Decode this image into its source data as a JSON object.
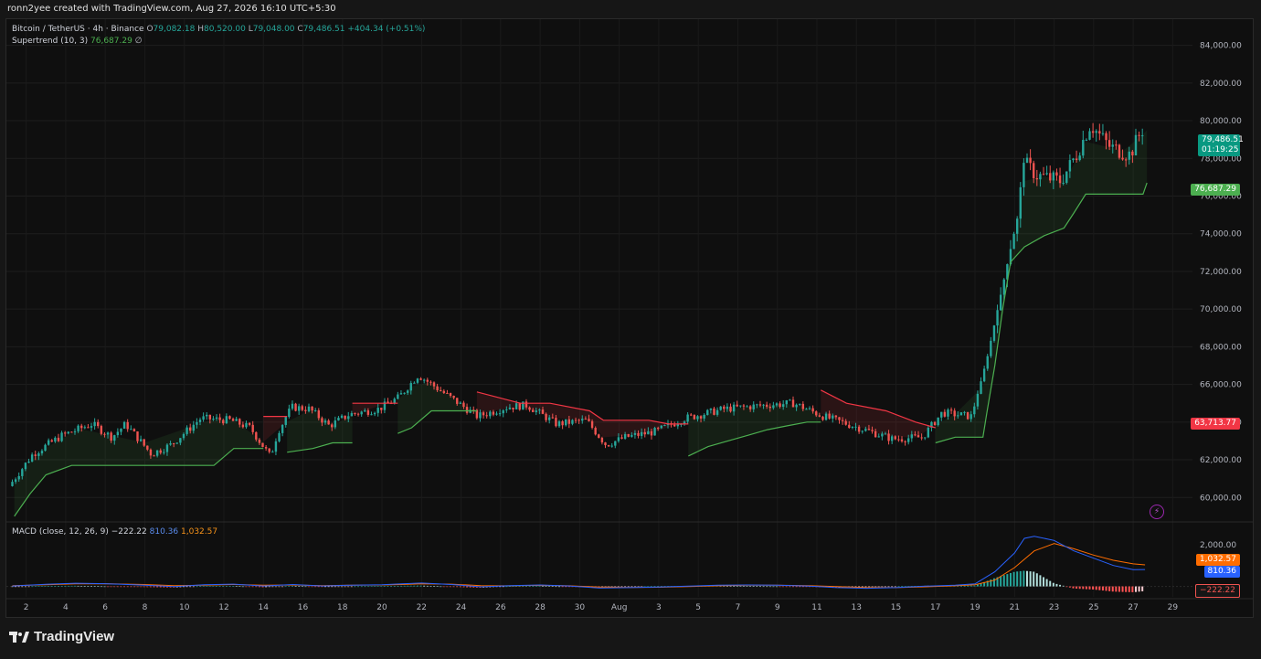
{
  "header": {
    "attribution": "ronn2yee created with TradingView.com, Aug 27, 2026 16:10 UTC+5:30"
  },
  "legend": {
    "symbol": "Bitcoin / TetherUS · 4h · Binance",
    "o_label": "O",
    "o_value": "79,082.18",
    "h_label": "H",
    "h_value": "80,520.00",
    "l_label": "L",
    "l_value": "79,048.00",
    "c_label": "C",
    "c_value": "79,486.51",
    "change": "+404.34 (+0.51%)",
    "supertrend_label": "Supertrend (10, 3)",
    "supertrend_value": "76,687.29",
    "supertrend_extra": "∅"
  },
  "macd_legend": {
    "label": "MACD (close, 12, 26, 9)",
    "hist_value": "−222.22",
    "macd_value": "810.36",
    "signal_value": "1,032.57"
  },
  "price_tags": {
    "last_price": "79,486.51",
    "countdown": "01:19:25",
    "supertrend": "76,687.29",
    "downtrend": "63,713.77",
    "signal": "1,032.57",
    "macd": "810.36",
    "hist": "−222.22"
  },
  "colors": {
    "up": "#26a69a",
    "down": "#ef5350",
    "supertrend_up": "#4caf50",
    "supertrend_down": "#f23645",
    "macd": "#2962ff",
    "signal": "#ff6d00",
    "background": "#0f0f0f"
  },
  "footer": {
    "brand": "TradingView",
    "logo_icon": "tradingview-logo-icon"
  },
  "chart_data": {
    "type": "candlestick",
    "title": "Bitcoin / TetherUS · 4h · Binance",
    "y_ticks": [
      "84,000.00",
      "82,000.00",
      "80,000.00",
      "78,000.00",
      "76,000.00",
      "74,000.00",
      "72,000.00",
      "70,000.00",
      "68,000.00",
      "66,000.00",
      "64,000.00",
      "62,000.00",
      "60,000.00"
    ],
    "y_tick_values": [
      84000,
      82000,
      80000,
      78000,
      76000,
      74000,
      72000,
      70000,
      68000,
      66000,
      64000,
      62000,
      60000
    ],
    "ylim": [
      58800,
      85000
    ],
    "x_ticks": [
      "2",
      "4",
      "6",
      "8",
      "10",
      "12",
      "14",
      "16",
      "18",
      "20",
      "22",
      "24",
      "26",
      "28",
      "30",
      "Aug",
      "3",
      "5",
      "7",
      "9",
      "11",
      "13",
      "15",
      "17",
      "19",
      "21",
      "23",
      "25",
      "27",
      "29"
    ],
    "x_tick_days": [
      2,
      4,
      6,
      8,
      10,
      12,
      14,
      16,
      18,
      20,
      22,
      24,
      26,
      28,
      30,
      32,
      34,
      36,
      38,
      40,
      42,
      44,
      46,
      48,
      50,
      52,
      54,
      56,
      58,
      60
    ],
    "price_anchors": [
      [
        1.3,
        60600
      ],
      [
        2.5,
        62300
      ],
      [
        4.0,
        63300
      ],
      [
        5.5,
        63900
      ],
      [
        6.5,
        63200
      ],
      [
        7.2,
        63900
      ],
      [
        8.5,
        62300
      ],
      [
        9.5,
        62800
      ],
      [
        11,
        64200
      ],
      [
        12.5,
        64100
      ],
      [
        13.5,
        63700
      ],
      [
        14.5,
        62200
      ],
      [
        15.5,
        64800
      ],
      [
        16.5,
        64700
      ],
      [
        17.5,
        63800
      ],
      [
        18.5,
        64400
      ],
      [
        20,
        64700
      ],
      [
        21,
        65300
      ],
      [
        22,
        66500
      ],
      [
        23.5,
        65400
      ],
      [
        25,
        64300
      ],
      [
        26.5,
        64800
      ],
      [
        27.5,
        64900
      ],
      [
        29,
        63900
      ],
      [
        30.5,
        64100
      ],
      [
        31.5,
        62800
      ],
      [
        32.5,
        63200
      ],
      [
        34,
        63500
      ],
      [
        35.5,
        64200
      ],
      [
        37.5,
        64700
      ],
      [
        39.5,
        64900
      ],
      [
        41,
        65000
      ],
      [
        42.5,
        64300
      ],
      [
        44,
        63800
      ],
      [
        46,
        63100
      ],
      [
        47.5,
        63200
      ],
      [
        48.5,
        64500
      ],
      [
        50,
        64300
      ],
      [
        50.8,
        67500
      ],
      [
        51.7,
        71900
      ],
      [
        52.3,
        74800
      ],
      [
        52.6,
        77800
      ],
      [
        53.3,
        77100
      ],
      [
        54.5,
        76800
      ],
      [
        55.3,
        78200
      ],
      [
        56.0,
        79800
      ],
      [
        57.0,
        78600
      ],
      [
        58.0,
        78200
      ],
      [
        58.6,
        79500
      ]
    ],
    "supertrend": {
      "value": 76687.29,
      "segments": [
        {
          "trend": "up",
          "points": [
            [
              1.4,
              59000
            ],
            [
              2.2,
              60200
            ],
            [
              3.0,
              61200
            ],
            [
              4.3,
              61700
            ],
            [
              4.8,
              61700
            ],
            [
              8.0,
              61700
            ],
            [
              11.5,
              61700
            ],
            [
              12.5,
              62600
            ],
            [
              14.0,
              62600
            ]
          ]
        },
        {
          "trend": "down",
          "points": [
            [
              14.0,
              64300
            ],
            [
              15.2,
              64300
            ]
          ]
        },
        {
          "trend": "up",
          "points": [
            [
              15.2,
              62400
            ],
            [
              16.5,
              62600
            ],
            [
              17.5,
              62900
            ],
            [
              18.5,
              62900
            ]
          ]
        },
        {
          "trend": "down",
          "points": [
            [
              18.5,
              65000
            ],
            [
              20.8,
              65000
            ]
          ]
        },
        {
          "trend": "up",
          "points": [
            [
              20.8,
              63400
            ],
            [
              21.5,
              63700
            ],
            [
              22.5,
              64600
            ],
            [
              24.8,
              64600
            ]
          ]
        },
        {
          "trend": "down",
          "points": [
            [
              24.8,
              65600
            ],
            [
              27.0,
              65000
            ],
            [
              28.5,
              65000
            ],
            [
              30.5,
              64600
            ],
            [
              31.2,
              64100
            ],
            [
              33.5,
              64100
            ],
            [
              34.5,
              63900
            ],
            [
              35.5,
              63900
            ]
          ]
        },
        {
          "trend": "up",
          "points": [
            [
              35.5,
              62200
            ],
            [
              36.5,
              62700
            ],
            [
              37.5,
              63000
            ],
            [
              38.5,
              63300
            ],
            [
              39.5,
              63600
            ],
            [
              40.5,
              63800
            ],
            [
              41.5,
              64000
            ],
            [
              42.2,
              64000
            ]
          ]
        },
        {
          "trend": "down",
          "points": [
            [
              42.2,
              65700
            ],
            [
              43.5,
              65000
            ],
            [
              45.5,
              64600
            ],
            [
              47.0,
              64000
            ],
            [
              48.0,
              63700
            ]
          ]
        },
        {
          "trend": "up",
          "points": [
            [
              48.0,
              62900
            ],
            [
              49.0,
              63200
            ],
            [
              50.4,
              63200
            ],
            [
              50.6,
              64500
            ],
            [
              51.0,
              67000
            ],
            [
              51.4,
              70000
            ],
            [
              51.8,
              72500
            ],
            [
              52.5,
              73300
            ],
            [
              53.5,
              73900
            ],
            [
              54.5,
              74300
            ],
            [
              55.0,
              75100
            ],
            [
              55.6,
              76100
            ],
            [
              57.5,
              76100
            ],
            [
              58.5,
              76100
            ],
            [
              58.7,
              76700
            ]
          ]
        }
      ]
    },
    "macd": {
      "macd_value": 810.36,
      "signal_value": 1032.57,
      "hist_value": -222.22,
      "macd_points": [
        [
          1.3,
          20
        ],
        [
          3,
          100
        ],
        [
          4.5,
          150
        ],
        [
          6,
          130
        ],
        [
          8,
          60
        ],
        [
          9.5,
          -10
        ],
        [
          11,
          80
        ],
        [
          12.5,
          110
        ],
        [
          14,
          20
        ],
        [
          15.5,
          90
        ],
        [
          17,
          20
        ],
        [
          18.5,
          60
        ],
        [
          20,
          80
        ],
        [
          21,
          120
        ],
        [
          22,
          160
        ],
        [
          23.5,
          90
        ],
        [
          25,
          -20
        ],
        [
          26.5,
          40
        ],
        [
          28,
          70
        ],
        [
          29.5,
          20
        ],
        [
          31,
          -80
        ],
        [
          32.5,
          -60
        ],
        [
          34,
          -30
        ],
        [
          35.5,
          10
        ],
        [
          37,
          60
        ],
        [
          38.5,
          70
        ],
        [
          40,
          60
        ],
        [
          41.5,
          20
        ],
        [
          43,
          -60
        ],
        [
          44.5,
          -90
        ],
        [
          46,
          -60
        ],
        [
          47.5,
          10
        ],
        [
          49,
          60
        ],
        [
          50,
          120
        ],
        [
          51,
          700
        ],
        [
          52,
          1600
        ],
        [
          52.5,
          2300
        ],
        [
          53,
          2400
        ],
        [
          54,
          2200
        ],
        [
          55,
          1700
        ],
        [
          56,
          1350
        ],
        [
          57,
          1000
        ],
        [
          58,
          800
        ],
        [
          58.6,
          810
        ]
      ],
      "signal_points": [
        [
          1.3,
          40
        ],
        [
          3,
          80
        ],
        [
          4.5,
          120
        ],
        [
          6,
          130
        ],
        [
          8,
          90
        ],
        [
          9.5,
          40
        ],
        [
          11,
          60
        ],
        [
          12.5,
          90
        ],
        [
          14,
          60
        ],
        [
          15.5,
          70
        ],
        [
          17,
          40
        ],
        [
          18.5,
          60
        ],
        [
          20,
          70
        ],
        [
          21,
          90
        ],
        [
          22,
          120
        ],
        [
          23.5,
          110
        ],
        [
          25,
          40
        ],
        [
          26.5,
          30
        ],
        [
          28,
          50
        ],
        [
          29.5,
          30
        ],
        [
          31,
          -30
        ],
        [
          32.5,
          -50
        ],
        [
          34,
          -40
        ],
        [
          35.5,
          -10
        ],
        [
          37,
          30
        ],
        [
          38.5,
          60
        ],
        [
          40,
          60
        ],
        [
          41.5,
          40
        ],
        [
          43,
          -10
        ],
        [
          44.5,
          -60
        ],
        [
          46,
          -60
        ],
        [
          47.5,
          -20
        ],
        [
          49,
          30
        ],
        [
          50,
          80
        ],
        [
          51,
          300
        ],
        [
          52,
          900
        ],
        [
          53,
          1700
        ],
        [
          54,
          2050
        ],
        [
          55,
          1800
        ],
        [
          56,
          1500
        ],
        [
          57,
          1250
        ],
        [
          58,
          1080
        ],
        [
          58.6,
          1032
        ]
      ],
      "hist_points": [
        [
          1.3,
          -20
        ],
        [
          3,
          20
        ],
        [
          4.5,
          30
        ],
        [
          6,
          0
        ],
        [
          8,
          -30
        ],
        [
          9.5,
          -50
        ],
        [
          11,
          20
        ],
        [
          12.5,
          20
        ],
        [
          14,
          -40
        ],
        [
          15.5,
          20
        ],
        [
          17,
          -20
        ],
        [
          18.5,
          0
        ],
        [
          20,
          10
        ],
        [
          21,
          30
        ],
        [
          22,
          40
        ],
        [
          23.5,
          -20
        ],
        [
          25,
          -60
        ],
        [
          26.5,
          10
        ],
        [
          28,
          20
        ],
        [
          29.5,
          -10
        ],
        [
          31,
          -50
        ],
        [
          32.5,
          -10
        ],
        [
          34,
          10
        ],
        [
          35.5,
          20
        ],
        [
          37,
          30
        ],
        [
          38.5,
          10
        ],
        [
          40,
          0
        ],
        [
          41.5,
          -20
        ],
        [
          43,
          -50
        ],
        [
          44.5,
          -30
        ],
        [
          46,
          0
        ],
        [
          47.5,
          30
        ],
        [
          49,
          30
        ],
        [
          50,
          40
        ],
        [
          51,
          400
        ],
        [
          52,
          700
        ],
        [
          52.5,
          750
        ],
        [
          53,
          700
        ],
        [
          54,
          150
        ],
        [
          55,
          -100
        ],
        [
          56,
          -150
        ],
        [
          57,
          -250
        ],
        [
          58,
          -280
        ],
        [
          58.6,
          -222
        ]
      ],
      "y_ticks": [
        "2,000.00"
      ],
      "ylim": [
        -500,
        3000
      ]
    }
  }
}
